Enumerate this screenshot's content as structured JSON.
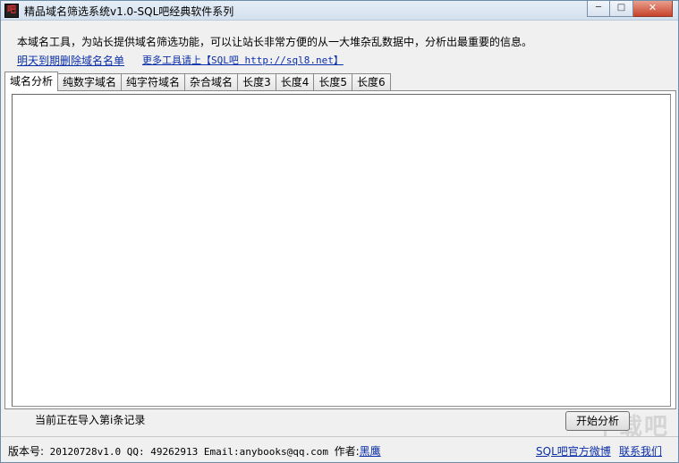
{
  "window": {
    "title": "精品域名筛选系统v1.0-SQL吧经典软件系列",
    "icon_text": "吧",
    "minimize_label": "─",
    "maximize_label": "□",
    "close_label": "✕"
  },
  "intro": {
    "description": "本域名工具，为站长提供域名筛选功能，可以让站长非常方便的从一大堆杂乱数据中，分析出最重要的信息。",
    "link_delete_list": "明天到期删除域名名单",
    "link_more_tools": "更多工具请上【SQL吧 http://sql8.net】"
  },
  "tabs": [
    {
      "label": "域名分析",
      "active": true
    },
    {
      "label": "纯数字域名",
      "active": false
    },
    {
      "label": "纯字符域名",
      "active": false
    },
    {
      "label": "杂合域名",
      "active": false
    },
    {
      "label": "长度3",
      "active": false
    },
    {
      "label": "长度4",
      "active": false
    },
    {
      "label": "长度5",
      "active": false
    },
    {
      "label": "长度6",
      "active": false
    }
  ],
  "main": {
    "textarea_value": "",
    "status_text": "当前正在导入第i条记录",
    "start_button": "开始分析",
    "watermark": "下载吧"
  },
  "footer": {
    "version_label": "版本号:",
    "version_value": " 20120728v1.0 ",
    "qq_label": "QQ:",
    "qq_value": " 49262913  ",
    "email_label": "Email:",
    "email_value": "anybooks@qq.com ",
    "author_label": "作者:",
    "author_link": "黑鹰",
    "weibo_link": "SQL吧官方微博",
    "contact_link": "联系我们"
  },
  "colors": {
    "link": "#0b2fa8",
    "close_button": "#c7432b"
  }
}
